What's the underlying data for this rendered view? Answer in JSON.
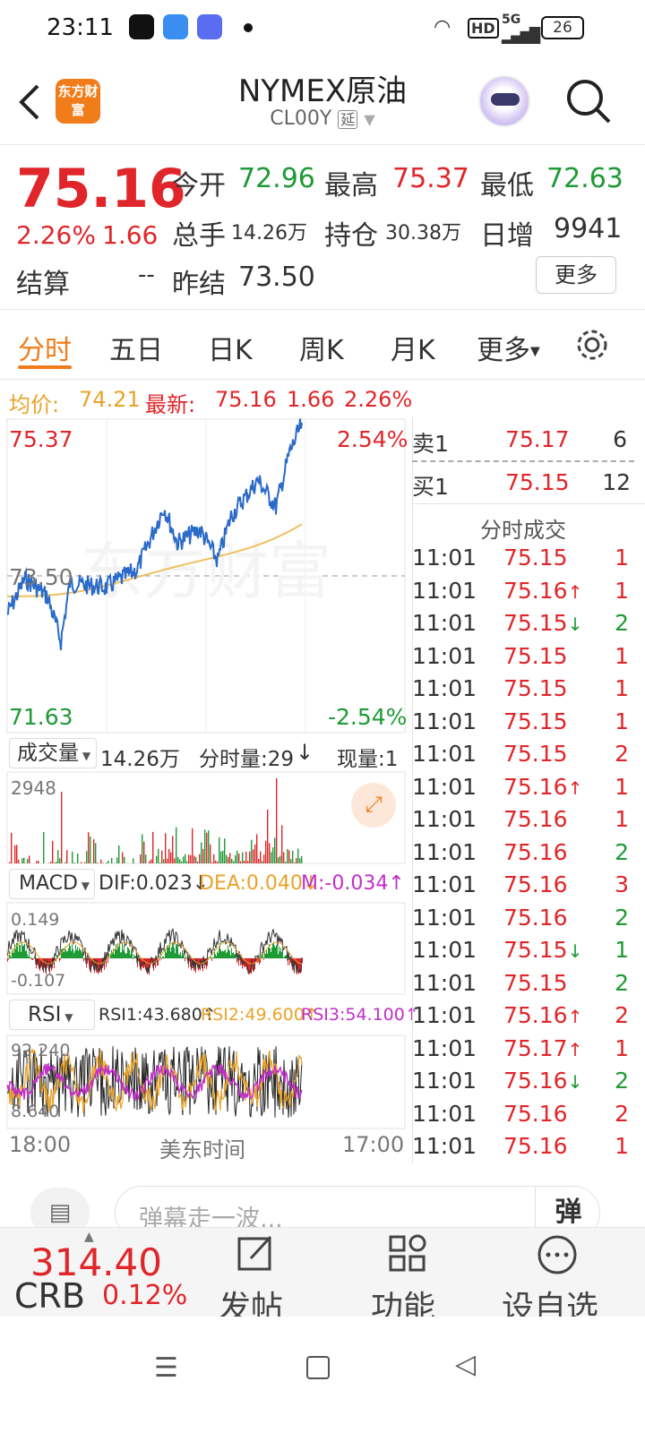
{
  "status": {
    "time": "23:11",
    "network": "HD",
    "signal": "5G",
    "battery": "26"
  },
  "header": {
    "title": "NYMEX原油",
    "code": "CL00Y",
    "delay_badge": "延",
    "logo_text": "东方财富"
  },
  "quote": {
    "price": "75.16",
    "change_pct": "2.26%",
    "change": "1.66",
    "open_label": "今开",
    "open": "72.96",
    "high_label": "最高",
    "high": "75.37",
    "low_label": "最低",
    "low": "72.63",
    "volume_label": "总手",
    "volume": "14.26万",
    "oi_label": "持仓",
    "oi": "30.38万",
    "daily_inc_label": "日增",
    "daily_inc": "9941",
    "settle_label": "结算",
    "settle": "--",
    "prev_settle_label": "昨结",
    "prev_settle": "73.50",
    "more_button": "更多"
  },
  "tabs": [
    "分时",
    "五日",
    "日K",
    "周K",
    "月K",
    "更多"
  ],
  "info": {
    "avg_label": "均价:",
    "avg": "74.21",
    "latest_label": "最新:",
    "latest": "75.16",
    "change": "1.66",
    "pct": "2.26%"
  },
  "chart": {
    "max_price": "75.37",
    "max_pct": "2.54%",
    "mid_price": "73.50",
    "min_price": "71.63",
    "min_pct": "-2.54%",
    "time_start": "18:00",
    "time_label": "美东时间",
    "time_end": "17:00"
  },
  "volume": {
    "label": "成交量",
    "total": "14.26万",
    "tick_label": "分时量:29",
    "tick_arrow": "↓",
    "cur_label": "现量:1",
    "max": "2948"
  },
  "macd": {
    "label": "MACD",
    "dif": "DIF:0.023",
    "dif_arrow": "↓",
    "dea": "DEA:0.040",
    "dea_arrow": "↓",
    "m": "M:-0.034",
    "m_arrow": "↑",
    "top": "0.149",
    "bottom": "-0.107"
  },
  "rsi": {
    "label": "RSI",
    "rsi1": "RSI1:43.680",
    "rsi1_arrow": "↑",
    "rsi2": "RSI2:49.600",
    "rsi2_arrow": "↑",
    "rsi3": "RSI3:54.100",
    "rsi3_arrow": "↑",
    "top": "92.240",
    "bottom": "8.640"
  },
  "orderbook": {
    "sell_label": "卖1",
    "sell_price": "75.17",
    "sell_qty": "6",
    "buy_label": "买1",
    "buy_price": "75.15",
    "buy_qty": "12",
    "ticks_title": "分时成交",
    "ticks": [
      {
        "time": "11:01",
        "price": "75.15",
        "arrow": "",
        "qty": "1",
        "qcolor": "red"
      },
      {
        "time": "11:01",
        "price": "75.16",
        "arrow": "↑",
        "qty": "1",
        "qcolor": "red"
      },
      {
        "time": "11:01",
        "price": "75.15",
        "arrow": "↓",
        "qty": "2",
        "qcolor": "green"
      },
      {
        "time": "11:01",
        "price": "75.15",
        "arrow": "",
        "qty": "1",
        "qcolor": "red"
      },
      {
        "time": "11:01",
        "price": "75.15",
        "arrow": "",
        "qty": "1",
        "qcolor": "red"
      },
      {
        "time": "11:01",
        "price": "75.15",
        "arrow": "",
        "qty": "1",
        "qcolor": "red"
      },
      {
        "time": "11:01",
        "price": "75.15",
        "arrow": "",
        "qty": "2",
        "qcolor": "red"
      },
      {
        "time": "11:01",
        "price": "75.16",
        "arrow": "↑",
        "qty": "1",
        "qcolor": "red"
      },
      {
        "time": "11:01",
        "price": "75.16",
        "arrow": "",
        "qty": "1",
        "qcolor": "red"
      },
      {
        "time": "11:01",
        "price": "75.16",
        "arrow": "",
        "qty": "2",
        "qcolor": "green"
      },
      {
        "time": "11:01",
        "price": "75.16",
        "arrow": "",
        "qty": "3",
        "qcolor": "red"
      },
      {
        "time": "11:01",
        "price": "75.16",
        "arrow": "",
        "qty": "2",
        "qcolor": "green"
      },
      {
        "time": "11:01",
        "price": "75.15",
        "arrow": "↓",
        "qty": "1",
        "qcolor": "green"
      },
      {
        "time": "11:01",
        "price": "75.15",
        "arrow": "",
        "qty": "2",
        "qcolor": "green"
      },
      {
        "time": "11:01",
        "price": "75.16",
        "arrow": "↑",
        "qty": "2",
        "qcolor": "red"
      },
      {
        "time": "11:01",
        "price": "75.17",
        "arrow": "↑",
        "qty": "1",
        "qcolor": "red"
      },
      {
        "time": "11:01",
        "price": "75.16",
        "arrow": "↓",
        "qty": "2",
        "qcolor": "green"
      },
      {
        "time": "11:01",
        "price": "75.16",
        "arrow": "",
        "qty": "2",
        "qcolor": "red"
      },
      {
        "time": "11:01",
        "price": "75.16",
        "arrow": "",
        "qty": "1",
        "qcolor": "red"
      }
    ]
  },
  "comment": {
    "placeholder": "弹幕走一波...",
    "danmu_button": "弹"
  },
  "bottom": {
    "index_value": "314.40",
    "index_name": "CRB",
    "index_pct": "0.12%",
    "post": "发帖",
    "function": "功能",
    "watchlist": "设自选"
  },
  "colors": {
    "up": "#e0262a",
    "down": "#1e9a36",
    "accent": "#f07c1a",
    "avg_line": "#f0c060",
    "price_line": "#2a6ac8"
  }
}
